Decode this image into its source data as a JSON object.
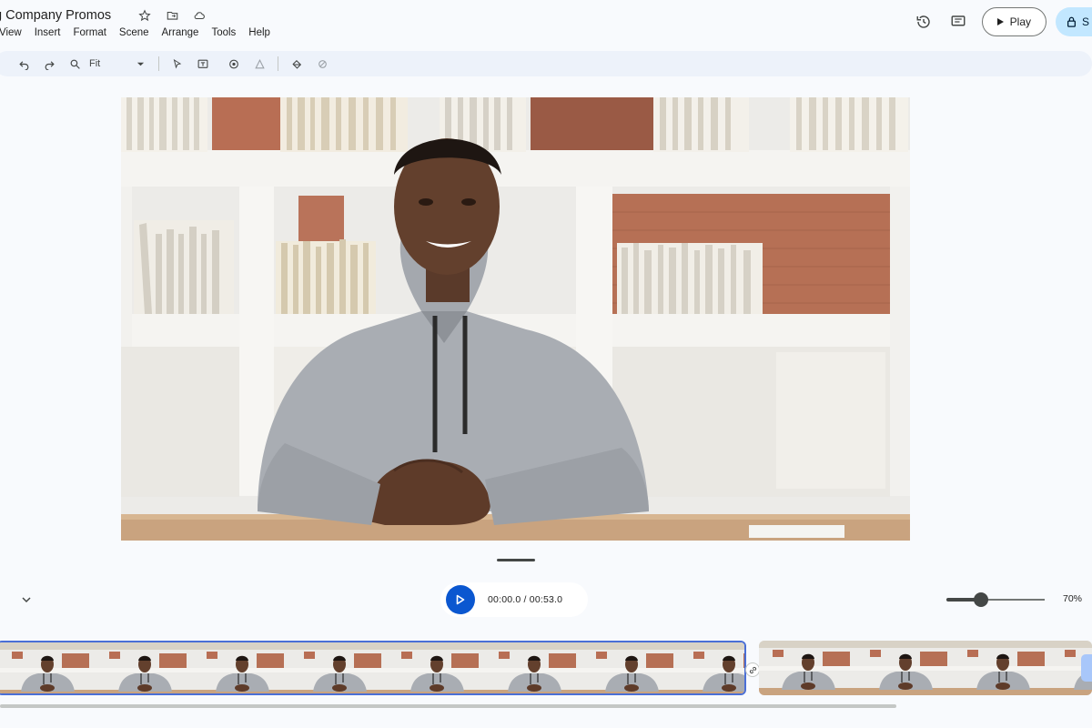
{
  "header": {
    "doc_title": "g Company Promos",
    "menu": [
      "View",
      "Insert",
      "Format",
      "Scene",
      "Arrange",
      "Tools",
      "Help"
    ],
    "play_label": "Play",
    "share_label": "S"
  },
  "toolbar": {
    "zoom_label": "Fit"
  },
  "playback": {
    "time": "00:00.0 / 00:53.0",
    "zoom_percent": "70%",
    "zoom_value": 0.35
  },
  "timeline": {
    "clip_count": 2
  },
  "colors": {
    "accent": "#0b57d0",
    "share_bg": "#c2e7ff",
    "selection_border": "#4a6fd6"
  },
  "icons": [
    "star-icon",
    "move-folder-icon",
    "cloud-icon",
    "history-icon",
    "comment-icon",
    "play-icon",
    "lock-icon",
    "undo-icon",
    "redo-icon",
    "zoom-icon",
    "cursor-icon",
    "text-box-icon",
    "image-icon",
    "shape-icon",
    "paint-icon",
    "effect-icon",
    "chevron-down-icon",
    "link-icon"
  ]
}
